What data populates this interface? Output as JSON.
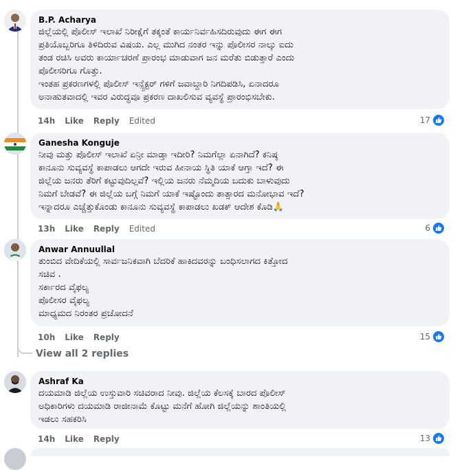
{
  "comments": [
    {
      "author": "B.P. Acharya",
      "text": "ಜಿಲ್ಲೆಯಲ್ಲಿ ಪೊಲೀಸ್ ಇಲಾಖೆ ನಿರೀಕ್ಷೆಗೆ ತಕ್ಕಂತೆ ಕಾರ್ಯನಿರ್ವಹಿಸದಿರುವುದು ಈಗ ಈಗ\nಪ್ರತಿಯೊಬ್ಬರಿಗೂ ತಿಳಿದಿರುವ ವಿಷಯ. ಎಲ್ಲ ಮುಗಿದ ನಂತರ ಇನ್ನು ಪೊಲೀಸರ ನಾಲ್ಕು ಐದು\nತಂಡ ರಚಿಸಿ ಅವರು ಕಾರ್ಯಾಚರಣೆ ಪ್ರಾರಂಭ ಮಾಡುವಾಗ ಜನ ಮರೆತು ಬಿಡುತ್ತಾರೆ ಎಂದು\nಪೊಲೀಸರಿಗೂ ಗೊತ್ತು.\nಇಂತಹ ಪ್ರಕರಣಗಳಲ್ಲಿ ಪೊಲೀಸ್ ಇನ್ಸ್ಪೆಕ್ಟರ್ ಗಳಿಗೆ ಜವಾಬ್ದಾರಿ ನಿಗದಿಪಡಿಸಿ, ಏನಾದರೂ\nಅನಾಹುತವಾದಲ್ಲಿ ಇವರ ವಿರುದ್ಧವೂ ಪ್ರಕರಣ ದಾಖಲಿಸುವ ವ್ಯವಸ್ಥೆ ಪ್ರಾರಂಭಿಸಬೇಕು.",
      "time": "14h",
      "like": "Like",
      "reply": "Reply",
      "edited": "Edited",
      "likes": "17"
    },
    {
      "author": "Ganesha Konguje",
      "text": "ನೀವು ಮತ್ತು ಪೊಲೀಸ್ ಇಲಾಖೆ ಏನ್ರೀ ಮಾಡ್ತಾ ಇದೀರಿ? ನಿಮಗೆಲ್ಲಾ ಏನಾಗಿದೆ? ಕನಿಷ್ಠ\nಕಾನೂನು ಸುವ್ಯವಸ್ಥೆ ಕಾಪಾಡಲು ಆಗದೇ ಇರುವ ಹೀನಾಯ ಸ್ಥಿತಿ ಯಾಕೆ ಆಗ್ತಾ ಇದೆ? ಈ\nಜಿಲ್ಲೆಯ ಜನರು ತೆರಿಗೆ ಕಟ್ಟುವುದಿಲ್ಲವೆ? ಇಲ್ಲಿಯ ಜನರು ನೆಮ್ಮದಿಯ ಬದುಕು ಬಾಳುವುದು\nನಿಮಗೆ ಬೇಡವೆ? ಈ ಜಿಲ್ಲೆಯ ಬಗ್ಗೆ ನಿಮಗೆ ಯಾಕೆ ಇಷ್ಟೊಂದು ತಾತ್ಸಾರದ ಮನೋಭಾವ ಇದೆ?\nಇನ್ನಾದರೂ ಎಚ್ಚೆತ್ತುಕೊಂಡು ಕಾನೂನು ಸುವ್ಯವಸ್ಥೆ ಕಾಪಾಡಲು ಖಡಕ್ ಆದೇಶ ಕೊಡಿ🙏",
      "time": "13h",
      "like": "Like",
      "reply": "Reply",
      "edited": "Edited",
      "likes": "6"
    },
    {
      "author": "Anwar Annuullal",
      "text": "ತುಂಬಿದ ವೇದಿಕೆಯಲ್ಲಿ ಸಾರ್ವಜನಿಕವಾಗಿ ಬೆದರಿಕೆ ಹಾಕಿದವರನ್ನು ಬಂಧಿಸಲಾಗದ ಕಿತ್ತೋದ\nಸಚಿವ .\nಸರ್ಕಾರದ ವೈಫಲ್ಯ\nಪೊಲೀಸರ ವೈಫಲ್ಯ\nಮಾಧ್ಯಮದ ನಿರಂತರ ಪ್ರಚೋದನೆ",
      "time": "10h",
      "like": "Like",
      "reply": "Reply",
      "likes": "15"
    },
    {
      "author": "Ashraf Ka",
      "text": "ದಯಮಾಡಿ ಜಿಲ್ಲೆಯ ಉಸ್ತುವಾರಿ ಸಚಿವರಾದ ನೀವು. ಜಿಲ್ಲೆಯ ಕೆಲಸಕ್ಕೆ ಬಾರದ ಪೊಲೀಸ್\nಅಧಿಕಾರಿಗಳು ದಯಮಾಡಿ ರಾಜೀನಾಮೆ ಕೊಟ್ಟು ಮನೆಗೆ ಹೋಗಿ ಜಿಲ್ಲೆಯನ್ನು ಶಾಂತಿಯಲ್ಲಿ\nಇಡಲು ಸಹಕರಿಸಿ",
      "time": "14h",
      "like": "Like",
      "reply": "Reply",
      "likes": "13"
    }
  ],
  "view_replies": "View all 2 replies",
  "accent_color": "#1877f2"
}
